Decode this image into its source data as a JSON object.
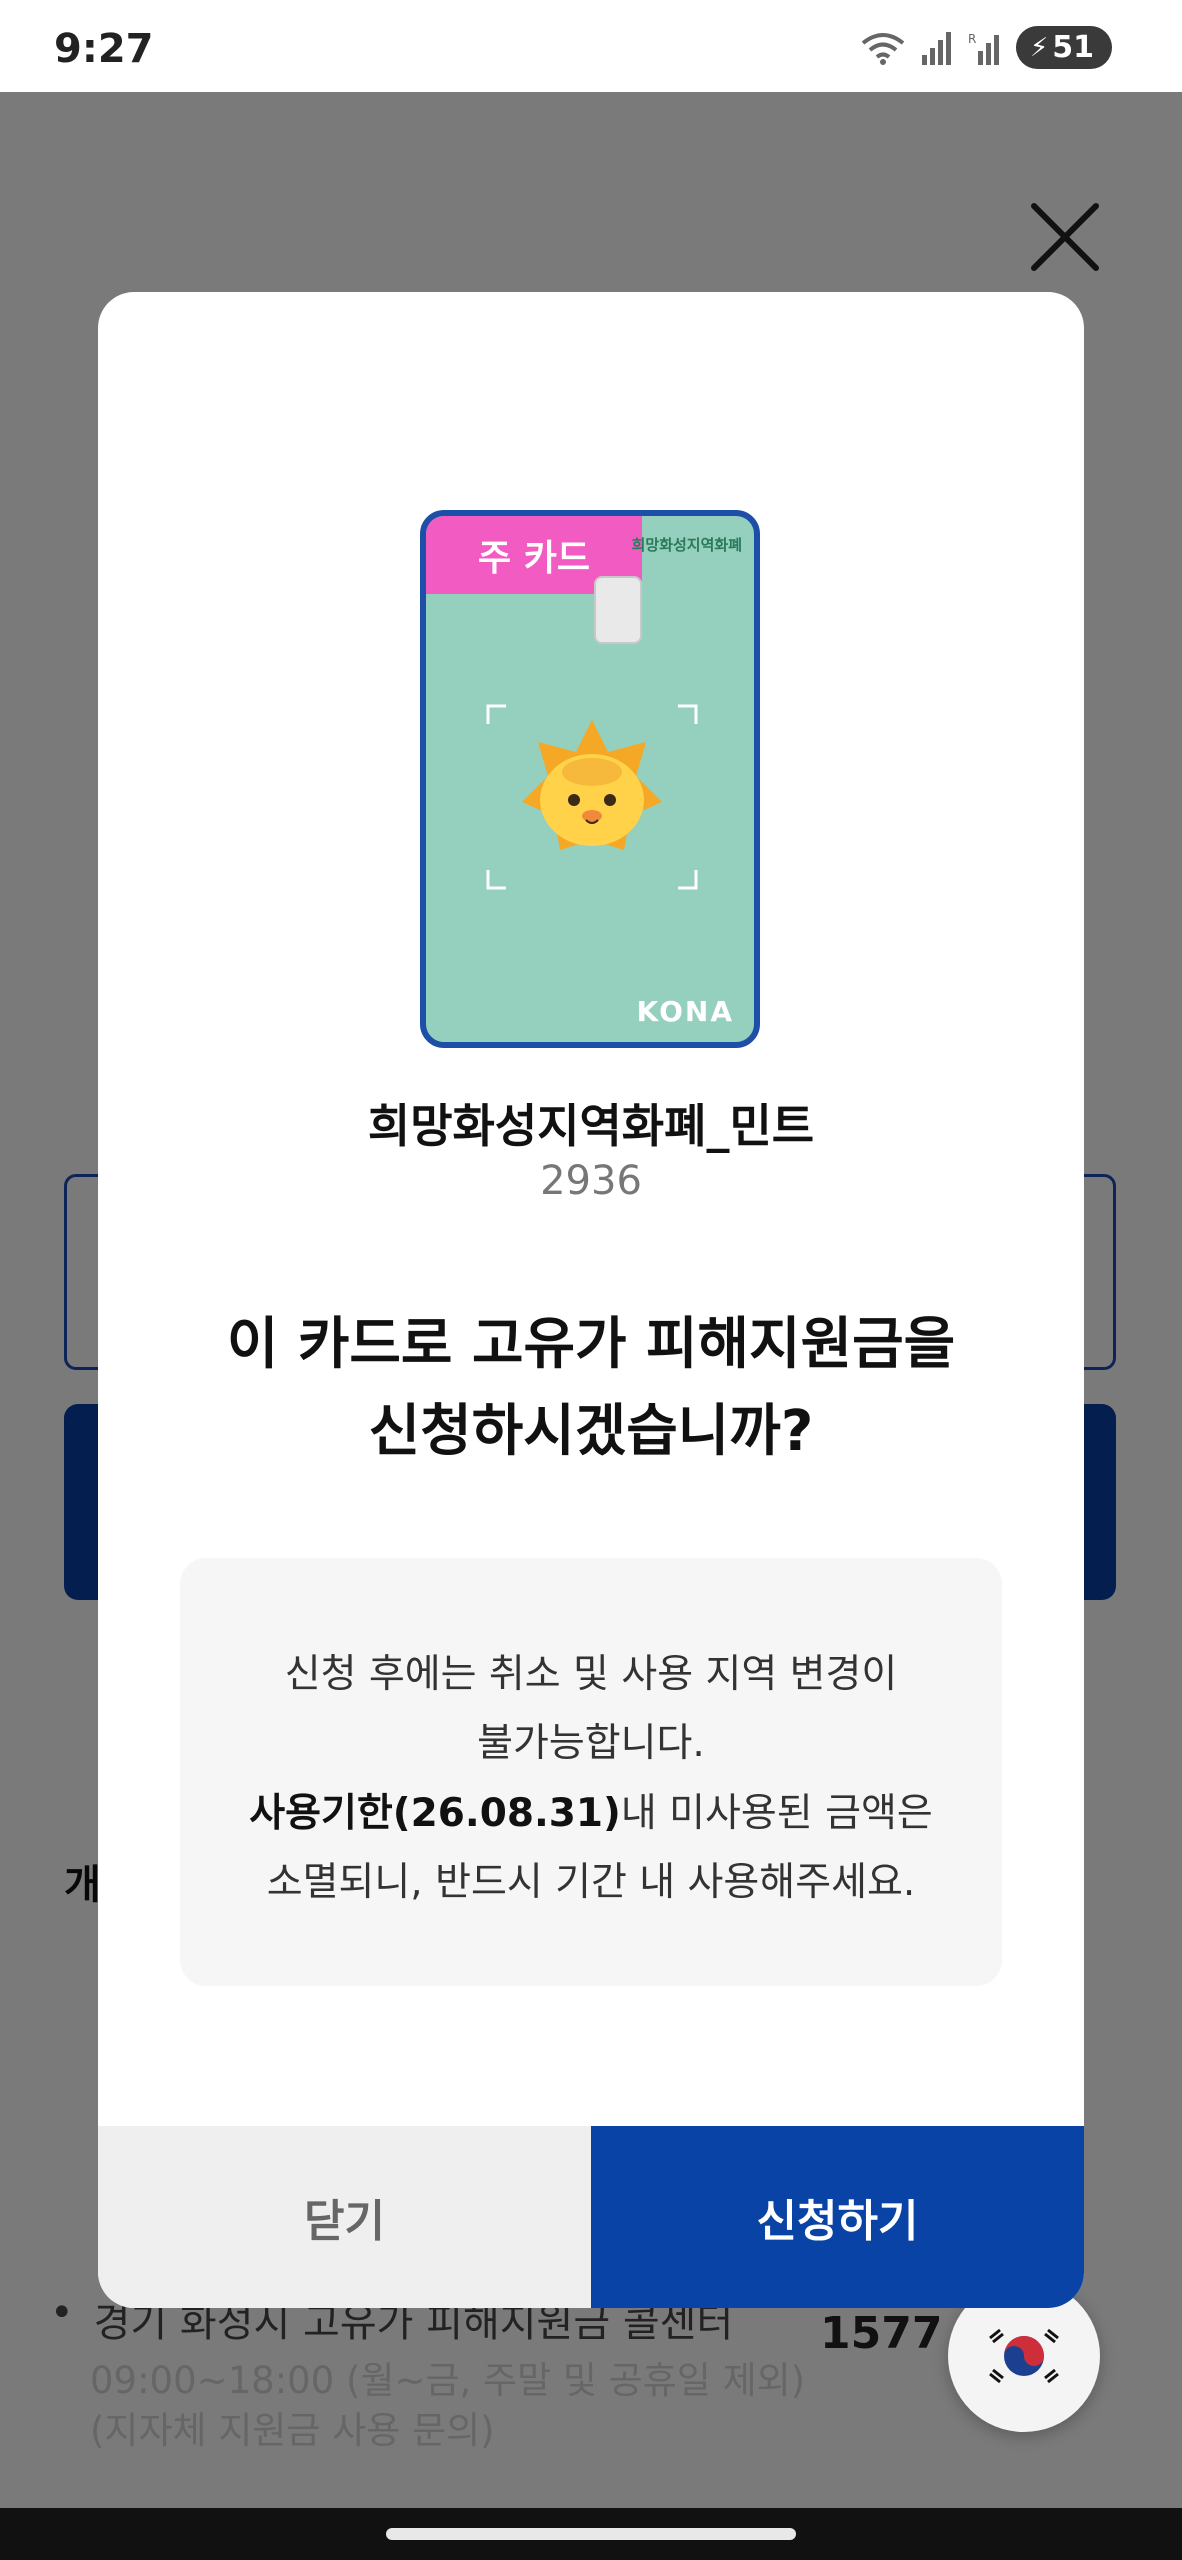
{
  "status_bar": {
    "time": "9:27",
    "battery": "51",
    "icons": [
      "wifi-icon",
      "signal-icon",
      "signal-roaming-icon",
      "battery-charging-icon"
    ]
  },
  "background": {
    "section_initial": "개",
    "list": [
      {
        "title": "경기 화성시 고유가 피해지원금 콜센터",
        "phone": "1577",
        "sub": [
          "09:00~18:00 (월~금, 주말 및 공휴일 제외)",
          "(지자체 지원금 사용 문의)"
        ]
      }
    ]
  },
  "modal": {
    "card": {
      "badge": "주 카드",
      "issuer_name": "희망화성지역화폐",
      "brand": "KONA",
      "colors": {
        "card": "#95cfbd",
        "border": "#1d4fa8",
        "badge": "#f15bc2"
      }
    },
    "card_name": "희망화성지역화폐_민트",
    "card_number": "2936",
    "question_line1": "이 카드로 고유가 피해지원금을",
    "question_line2": "신청하시겠습니까?",
    "notice": {
      "line1": "신청 후에는 취소 및 사용 지역 변경이",
      "line2": "불가능합니다.",
      "line3_bold": "사용기한(26.08.31)",
      "line3_rest": "내 미사용된 금액은",
      "line4": "소멸되니, 반드시 기간 내 사용해주세요."
    },
    "buttons": {
      "close_label": "닫기",
      "apply_label": "신청하기"
    },
    "colors": {
      "primary": "#0a43a6",
      "secondary_bg": "#efefef"
    }
  }
}
